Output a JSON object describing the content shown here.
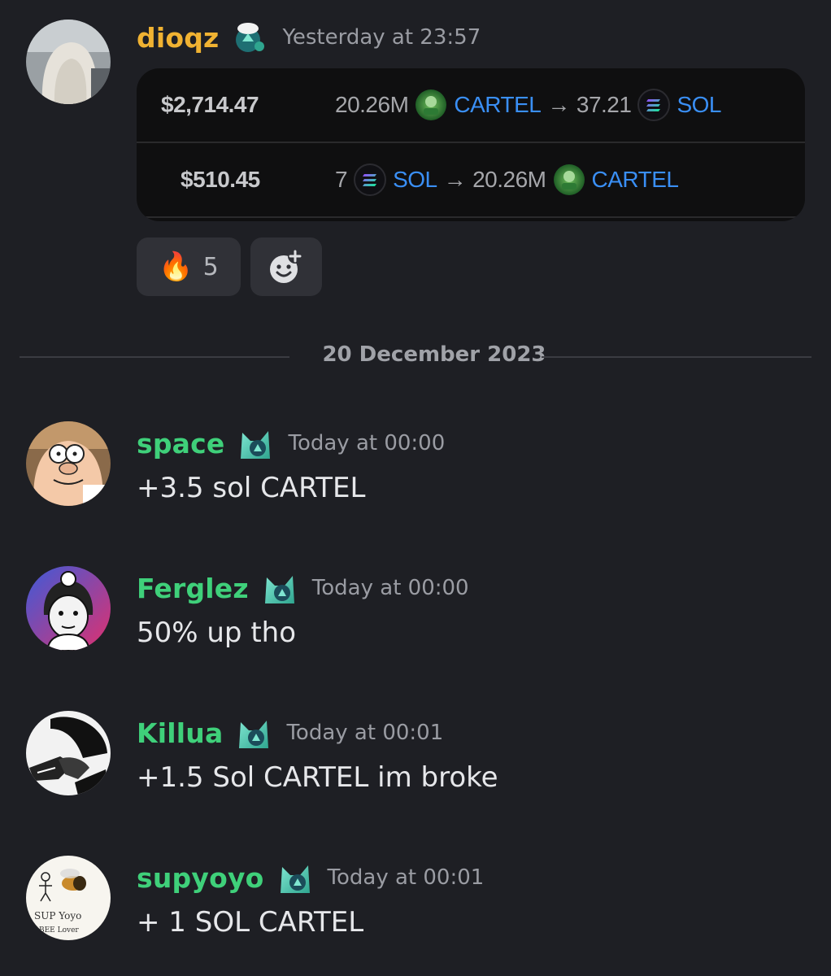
{
  "colors": {
    "background": "#1e1f24",
    "username_gold": "#f0b232",
    "username_green": "#3fd07a",
    "token_blue": "#3a8ff5"
  },
  "messages": [
    {
      "username": "dioqz",
      "timestamp": "Yesterday at 23:57",
      "badge_icon": "chef-hat-badge-icon",
      "embed": {
        "rows": [
          {
            "usd": "$2,714.47",
            "amount_in": "20.26M",
            "token_in": "CARTEL",
            "amount_out": "37.21",
            "token_out": "SOL"
          },
          {
            "usd": "$510.45",
            "amount_in": "7",
            "token_in": "SOL",
            "amount_out": "20.26M",
            "token_out": "CARTEL"
          }
        ],
        "arrow": "→"
      },
      "reactions": [
        {
          "emoji": "🔥",
          "count": "5"
        }
      ]
    }
  ],
  "date_divider": "20 December 2023",
  "chat": [
    {
      "username": "space",
      "timestamp": "Today at 00:00",
      "content": "+3.5 sol CARTEL"
    },
    {
      "username": "Ferglez",
      "timestamp": "Today at 00:00",
      "content": "50% up tho"
    },
    {
      "username": "Killua",
      "timestamp": "Today at 00:01",
      "content": "+1.5 Sol CARTEL im broke"
    },
    {
      "username": "supyoyo",
      "timestamp": "Today at 00:01",
      "content": "+ 1 SOL CARTEL"
    }
  ]
}
